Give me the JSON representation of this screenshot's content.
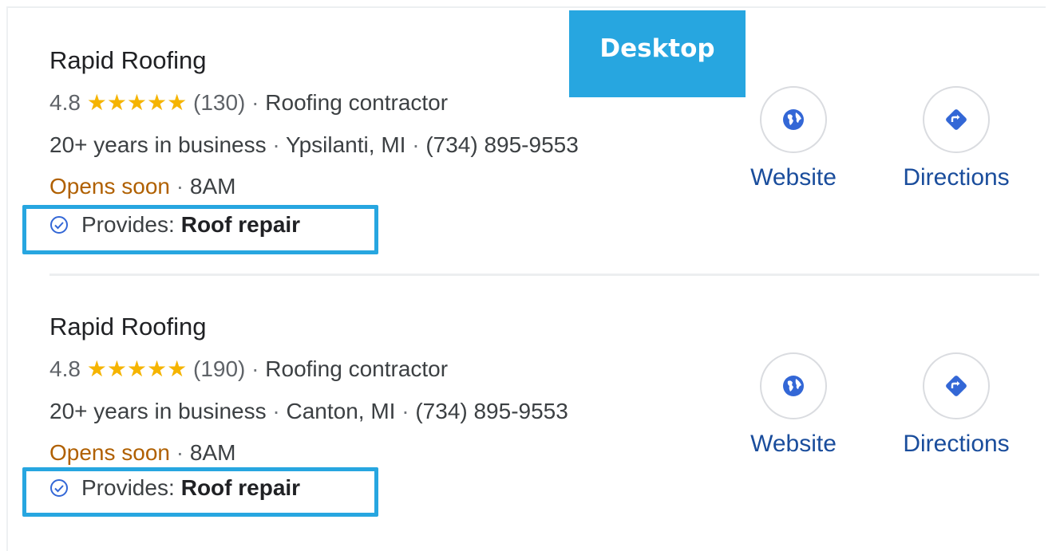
{
  "badge": {
    "label": "Desktop"
  },
  "listings": [
    {
      "name": "Rapid Roofing",
      "rating": "4.8",
      "stars": "★★★★★",
      "reviews": "(130)",
      "category": "Roofing contractor",
      "years": "20+ years in business",
      "location": "Ypsilanti, MI",
      "phone": "(734) 895-9553",
      "hours_status": "Opens soon",
      "hours_time": "8AM",
      "provides_label": "Provides:",
      "provides_value": "Roof repair",
      "website_label": "Website",
      "directions_label": "Directions"
    },
    {
      "name": "Rapid Roofing",
      "rating": "4.8",
      "stars": "★★★★★",
      "reviews": "(190)",
      "category": "Roofing contractor",
      "years": "20+ years in business",
      "location": "Canton, MI",
      "phone": "(734) 895-9553",
      "hours_status": "Opens soon",
      "hours_time": "8AM",
      "provides_label": "Provides:",
      "provides_value": "Roof repair",
      "website_label": "Website",
      "directions_label": "Directions"
    }
  ],
  "separator": "·",
  "icons": {
    "website": "globe-icon",
    "directions": "directions-diamond-icon",
    "provides": "check-circle-icon"
  },
  "colors": {
    "highlight": "#27a6e0",
    "star": "#f5b400",
    "link": "#1a4d9c",
    "opens_soon": "#b06000",
    "icon_blue": "#3367d6"
  }
}
